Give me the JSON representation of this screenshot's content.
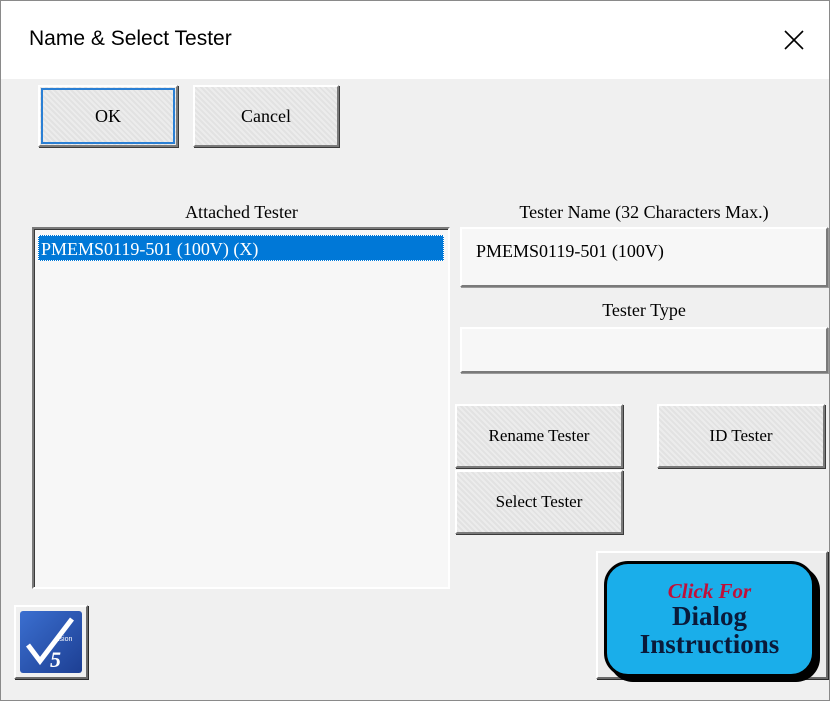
{
  "window": {
    "title": "Name & Select Tester"
  },
  "buttons": {
    "ok": "OK",
    "cancel": "Cancel",
    "rename": "Rename Tester",
    "id": "ID Tester",
    "select": "Select Tester"
  },
  "attached": {
    "label": "Attached Tester",
    "items": [
      "PMEMS0119-501 (100V) (X)"
    ],
    "selected_index": 0
  },
  "tester_name": {
    "label": "Tester Name (32 Characters Max.)",
    "value": "PMEMS0119-501 (100V)"
  },
  "tester_type": {
    "label": "Tester Type",
    "value": ""
  },
  "instructions": {
    "line1": "Click For",
    "line2": "Dialog",
    "line3": "Instructions"
  },
  "logo": {
    "text": "V5",
    "small": "ision",
    "icon": "checkmark-logo-icon"
  },
  "colors": {
    "selection": "#0078d7",
    "instructions_bg": "#1aaeea",
    "click_for": "#c0103a"
  }
}
